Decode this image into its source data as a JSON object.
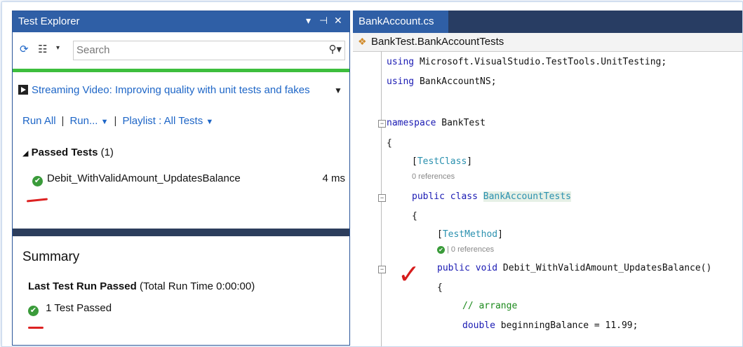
{
  "test_explorer": {
    "title": "Test Explorer",
    "controls": {
      "dropdown": "▾",
      "pin": "⊣",
      "close": "✕"
    },
    "search_placeholder": "Search",
    "video_link": "Streaming Video: Improving quality with unit tests and fakes",
    "links": {
      "run_all": "Run All",
      "run": "Run...",
      "playlist": "Playlist : All Tests"
    },
    "group": {
      "label": "Passed Tests",
      "count": "(1)"
    },
    "tests": [
      {
        "name": "Debit_WithValidAmount_UpdatesBalance",
        "duration": "4 ms",
        "status": "passed"
      }
    ],
    "summary": {
      "title": "Summary",
      "last_run": "Last Test Run Passed",
      "run_time": "(Total Run Time 0:00:00)",
      "passed_count": "1 Test Passed"
    },
    "colors": {
      "title_bar": "#2f5fa6",
      "progress": "#3dbe3d",
      "link": "#1e66c7",
      "pass": "#3a9b3a"
    }
  },
  "editor": {
    "tab": "BankAccount.cs",
    "nav": "BankTest.BankAccountTests",
    "code": {
      "using1_kw": "using",
      "using1_ns": "Microsoft.VisualStudio.TestTools.UnitTesting;",
      "using2_kw": "using",
      "using2_ns": "BankAccountNS;",
      "ns_kw": "namespace",
      "ns_name": "BankTest",
      "brace_open": "{",
      "test_class_attr": "TestClass",
      "refs_class": "0 references",
      "class_kw": "public class",
      "class_name": "BankAccountTests",
      "test_method_attr": "TestMethod",
      "refs_method": "0 references",
      "method_kw": "public void",
      "method_sig": "Debit_WithValidAmount_UpdatesBalance()",
      "comment": "// arrange",
      "decl_kw": "double",
      "decl_rest": "beginningBalance = 11.99;"
    }
  }
}
